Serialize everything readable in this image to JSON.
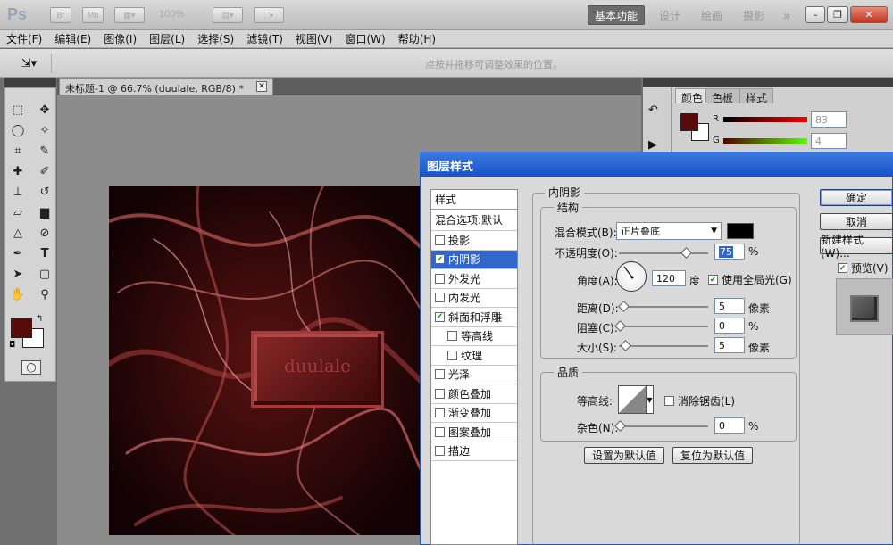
{
  "app": {
    "logo": "Ps",
    "zoom": "100%",
    "workspaces": [
      "基本功能",
      "设计",
      "绘画",
      "摄影"
    ],
    "more": "»"
  },
  "menus": [
    "文件(F)",
    "编辑(E)",
    "图像(I)",
    "图层(L)",
    "选择(S)",
    "滤镜(T)",
    "视图(V)",
    "窗口(W)",
    "帮助(H)"
  ],
  "options": {
    "hint": "点按并拖移可调整效果的位置。"
  },
  "document": {
    "tab_title": "未标题-1 @ 66.7% (duulale, RGB/8) *",
    "button_text": "duulale"
  },
  "color_panel": {
    "tabs": [
      "颜色",
      "色板",
      "样式"
    ],
    "R": {
      "label": "R",
      "value": "83"
    },
    "G": {
      "label": "G",
      "value": "4"
    }
  },
  "dialog": {
    "title": "图层样式",
    "styles_header": "样式",
    "blend_options": "混合选项:默认",
    "items": [
      {
        "label": "投影",
        "checked": false,
        "selected": false,
        "indent": false
      },
      {
        "label": "内阴影",
        "checked": true,
        "selected": true,
        "indent": false
      },
      {
        "label": "外发光",
        "checked": false,
        "selected": false,
        "indent": false
      },
      {
        "label": "内发光",
        "checked": false,
        "selected": false,
        "indent": false
      },
      {
        "label": "斜面和浮雕",
        "checked": true,
        "selected": false,
        "indent": false
      },
      {
        "label": "等高线",
        "checked": false,
        "selected": false,
        "indent": true
      },
      {
        "label": "纹理",
        "checked": false,
        "selected": false,
        "indent": true
      },
      {
        "label": "光泽",
        "checked": false,
        "selected": false,
        "indent": false
      },
      {
        "label": "颜色叠加",
        "checked": false,
        "selected": false,
        "indent": false
      },
      {
        "label": "渐变叠加",
        "checked": false,
        "selected": false,
        "indent": false
      },
      {
        "label": "图案叠加",
        "checked": false,
        "selected": false,
        "indent": false
      },
      {
        "label": "描边",
        "checked": false,
        "selected": false,
        "indent": false
      }
    ],
    "section_title": "内阴影",
    "structure": "结构",
    "blend_mode_label": "混合模式(B):",
    "blend_mode_value": "正片叠底",
    "opacity_label": "不透明度(O):",
    "opacity_value": "75",
    "opacity_level": 0.75,
    "percent": "%",
    "angle_label": "角度(A):",
    "angle_value": "120",
    "degree": "度",
    "global_light": "使用全局光(G)",
    "distance_label": "距离(D):",
    "distance_value": "5",
    "choke_label": "阻塞(C):",
    "choke_value": "0",
    "size_label": "大小(S):",
    "size_value": "5",
    "pixels": "像素",
    "quality": "品质",
    "contour_label": "等高线:",
    "anti_alias": "消除锯齿(L)",
    "noise_label": "杂色(N):",
    "noise_value": "0",
    "set_default": "设置为默认值",
    "reset_default": "复位为默认值",
    "ok": "确定",
    "cancel": "取消",
    "new_style": "新建样式(W)...",
    "preview": "预览(V)"
  },
  "colors": {
    "accent": "#3366cc",
    "foreground": "#5a0a0a",
    "artwork_bg": "#1a0506"
  }
}
